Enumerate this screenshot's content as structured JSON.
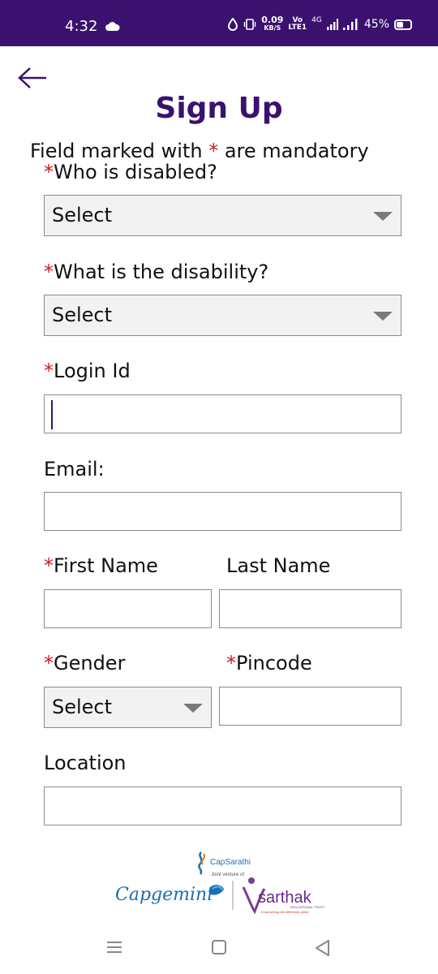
{
  "status_bar": {
    "time": "4:32",
    "net_speed_value": "0.09",
    "net_speed_unit": "KB/S",
    "volte_top": "Vo",
    "volte_bottom": "LTE1",
    "network": "4G",
    "battery_percent": "45%",
    "battery_level": 0.45,
    "background_color": "#3b1170"
  },
  "header": {
    "back_icon": "arrow-left-icon",
    "title": "Sign Up",
    "mandatory_note_prefix": "Field marked with ",
    "mandatory_star": "*",
    "mandatory_note_suffix": " are mandatory"
  },
  "form": {
    "required_star": "*",
    "who_disabled": {
      "label": "Who is disabled?",
      "value": "Select"
    },
    "disability": {
      "label": "What is the disability?",
      "value": "Select"
    },
    "login_id": {
      "label": "Login Id",
      "value": ""
    },
    "email": {
      "label": "Email:",
      "value": ""
    },
    "first_name": {
      "label": "First Name",
      "value": ""
    },
    "last_name": {
      "label": "Last Name",
      "value": ""
    },
    "gender": {
      "label": "Gender",
      "value": "Select"
    },
    "pincode": {
      "label": "Pincode",
      "value": ""
    },
    "location": {
      "label": "Location",
      "value": ""
    }
  },
  "footer": {
    "capsarathi": "CapSarathi",
    "joint_venture": "Joint venture of",
    "capgemini": "Capgemini",
    "sarthak": "sarthak",
    "sarthak_sub": "EDUCATIONAL TRUST",
    "sarthak_tagline": "Empowering the differently abled"
  },
  "nav_bar": {
    "icons": [
      "recents-icon",
      "home-icon",
      "back-triangle-icon"
    ]
  },
  "colors": {
    "brand_purple": "#3b1170",
    "required_red": "#cc1b1b",
    "capgemini_blue": "#1a6fb3"
  }
}
